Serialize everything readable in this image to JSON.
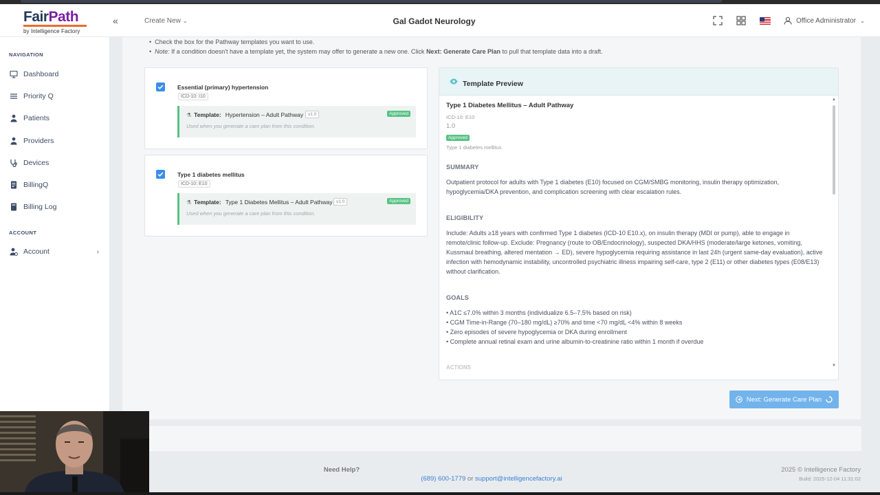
{
  "brand": {
    "name_1": "Fair",
    "name_2": "Path",
    "tagline": "by Intelligence Factory"
  },
  "header": {
    "collapse_glyph": "«",
    "create_new": "Create New",
    "practice": "Gal Gadot Neurology",
    "user": "Office Administrator",
    "icons": [
      "fullscreen-icon",
      "apps-grid-icon",
      "us-flag-icon",
      "user-icon"
    ]
  },
  "sidebar": {
    "nav_heading": "NAVIGATION",
    "items": [
      {
        "label": "Dashboard",
        "icon": "monitor-icon"
      },
      {
        "label": "Priority Q",
        "icon": "list-icon"
      },
      {
        "label": "Patients",
        "icon": "patient-icon"
      },
      {
        "label": "Providers",
        "icon": "provider-icon"
      },
      {
        "label": "Devices",
        "icon": "stethoscope-icon"
      },
      {
        "label": "BillingQ",
        "icon": "billing-icon"
      },
      {
        "label": "Billing Log",
        "icon": "book-icon"
      }
    ],
    "account_heading": "ACCOUNT",
    "account_item": {
      "label": "Account",
      "icon": "user-gear-icon",
      "chevron": "›"
    }
  },
  "instructions": {
    "line1": "Check the box for the Pathway templates you want to use.",
    "line2_note": "Note:",
    "line2_a": " If a condition doesn't have a template yet, the system may offer to generate a new one. Click ",
    "line2_bold": "Next: Generate Care Plan",
    "line2_b": " to pull that template data into a draft."
  },
  "conditions": [
    {
      "checked": true,
      "name": "Essential (primary) hypertension",
      "icd": "ICD-10: I10",
      "template_label": "Template:",
      "template_name": "Hypertension – Adult Pathway",
      "version": "v1.0",
      "status": "Approved",
      "hint": "Used when you generate a care plan from this condition."
    },
    {
      "checked": true,
      "name": "Type 1 diabetes mellitus",
      "icd": "ICD-10: E10",
      "template_label": "Template:",
      "template_name": "Type 1 Diabetes Mellitus – Adult Pathway",
      "version": "v1.0",
      "status": "Approved",
      "hint": "Used when you generate a care plan from this condition."
    }
  ],
  "preview": {
    "title": "Template Preview",
    "template_name": "Type 1 Diabetes Mellitus – Adult Pathway",
    "icd": "ICD-10: E10",
    "version": "1.0",
    "status": "Approved",
    "condition": "Type 1 diabetes mellitus",
    "summary_heading": "SUMMARY",
    "summary": "Outpatient protocol for adults with Type 1 diabetes (E10) focused on CGM/SMBG monitoring, insulin therapy optimization, hypoglycemia/DKA prevention, and complication screening with clear escalation rules.",
    "eligibility_heading": "ELIGIBILITY",
    "eligibility": "Include: Adults ≥18 years with confirmed Type 1 diabetes (ICD-10 E10.x), on insulin therapy (MDI or pump), able to engage in remote/clinic follow-up. Exclude: Pregnancy (route to OB/Endocrinology), suspected DKA/HHS (moderate/large ketones, vomiting, Kussmaul breathing, altered mentation → ED), severe hypoglycemia requiring assistance in last 24h (urgent same-day evaluation), active infection with hemodynamic instability, uncontrolled psychiatric illness impairing self-care, type 2 (E11) or other diabetes types (E08/E13) without clarification.",
    "goals_heading": "GOALS",
    "goals": [
      "• A1C ≤7.0% within 3 months (individualize 6.5–7.5% based on risk)",
      "• CGM Time-in-Range (70–180 mg/dL) ≥70% and time <70 mg/dL <4% within 8 weeks",
      "• Zero episodes of severe hypoglycemia or DKA during enrollment",
      "• Complete annual retinal exam and urine albumin-to-creatinine ratio within 1 month if overdue"
    ],
    "next_heading": "ACTIONS"
  },
  "next_button": "Next: Generate Care Plan",
  "footer": {
    "help_title": "Need Help?",
    "phone": "(689) 600-1779",
    "or": " or ",
    "email": "support@intelligencefactory.ai",
    "copyright": "2025 © Intelligence Factory",
    "build": "Build: 2025-12-04 11:31:02"
  },
  "colors": {
    "accent": "#3b8ee8",
    "approved": "#58c283",
    "brand_navy": "#23395b",
    "brand_purple": "#7b1fa2",
    "brand_orange": "#e96d2f"
  }
}
